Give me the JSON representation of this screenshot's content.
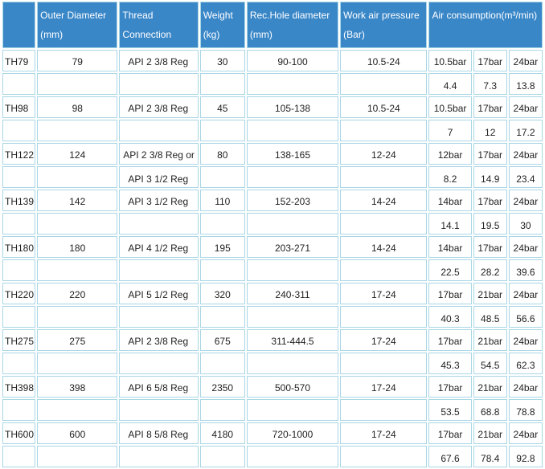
{
  "headers": {
    "model": "",
    "outer_diameter": [
      "Outer Diameter",
      "(mm)"
    ],
    "thread": [
      "Thread",
      "Connection"
    ],
    "weight": [
      "Weight",
      "(kg)"
    ],
    "hole": [
      "Rec.Hole diameter",
      "(mm)"
    ],
    "pressure": [
      "Work air pressure",
      "(Bar)"
    ],
    "air": [
      "Air consumption(m³/min)"
    ]
  },
  "rows": [
    {
      "model": "TH79",
      "od": "79",
      "thread": "API 2 3/8 Reg",
      "thread2": "",
      "weight": "30",
      "hole": "90-100",
      "pressure": "10.5-24",
      "air_labels": [
        "10.5bar",
        "17bar",
        "24bar"
      ],
      "air_values": [
        "4.4",
        "7.3",
        "13.8"
      ]
    },
    {
      "model": "TH98",
      "od": "98",
      "thread": "API 2 3/8 Reg",
      "thread2": "",
      "weight": "45",
      "hole": "105-138",
      "pressure": "10.5-24",
      "air_labels": [
        "10.5bar",
        "17bar",
        "24bar"
      ],
      "air_values": [
        "7",
        "12",
        "17.2"
      ]
    },
    {
      "model": "TH122",
      "od": "124",
      "thread": "API 2 3/8 Reg or",
      "thread2": "API 3 1/2 Reg",
      "weight": "80",
      "hole": "138-165",
      "pressure": "12-24",
      "air_labels": [
        "12bar",
        "17bar",
        "24bar"
      ],
      "air_values": [
        "8.2",
        "14.9",
        "23.4"
      ]
    },
    {
      "model": "TH139",
      "od": "142",
      "thread": "API 3 1/2 Reg",
      "thread2": "",
      "weight": "110",
      "hole": "152-203",
      "pressure": "14-24",
      "air_labels": [
        "14bar",
        "17bar",
        "24bar"
      ],
      "air_values": [
        "14.1",
        "19.5",
        "30"
      ]
    },
    {
      "model": "TH180",
      "od": "180",
      "thread": "API 4 1/2 Reg",
      "thread2": "",
      "weight": "195",
      "hole": "203-271",
      "pressure": "14-24",
      "air_labels": [
        "14bar",
        "17bar",
        "24bar"
      ],
      "air_values": [
        "22.5",
        "28.2",
        "39.6"
      ]
    },
    {
      "model": "TH220",
      "od": "220",
      "thread": "API 5 1/2 Reg",
      "thread2": "",
      "weight": "320",
      "hole": "240-311",
      "pressure": "17-24",
      "air_labels": [
        "17bar",
        "21bar",
        "24bar"
      ],
      "air_values": [
        "40.3",
        "48.5",
        "56.6"
      ]
    },
    {
      "model": "TH275",
      "od": "275",
      "thread": "API 2 3/8 Reg",
      "thread2": "",
      "weight": "675",
      "hole": "311-444.5",
      "pressure": "17-24",
      "air_labels": [
        "17bar",
        "21bar",
        "24bar"
      ],
      "air_values": [
        "45.3",
        "54.5",
        "62.3"
      ]
    },
    {
      "model": "TH398",
      "od": "398",
      "thread": "API 6 5/8 Reg",
      "thread2": "",
      "weight": "2350",
      "hole": "500-570",
      "pressure": "17-24",
      "air_labels": [
        "17bar",
        "21bar",
        "24bar"
      ],
      "air_values": [
        "53.5",
        "68.8",
        "78.8"
      ]
    },
    {
      "model": "TH600",
      "od": "600",
      "thread": "API 8 5/8 Reg",
      "thread2": "",
      "weight": "4180",
      "hole": "720-1000",
      "pressure": "17-24",
      "air_labels": [
        "17bar",
        "21bar",
        "24bar"
      ],
      "air_values": [
        "67.6",
        "78.4",
        "92.8"
      ]
    }
  ]
}
